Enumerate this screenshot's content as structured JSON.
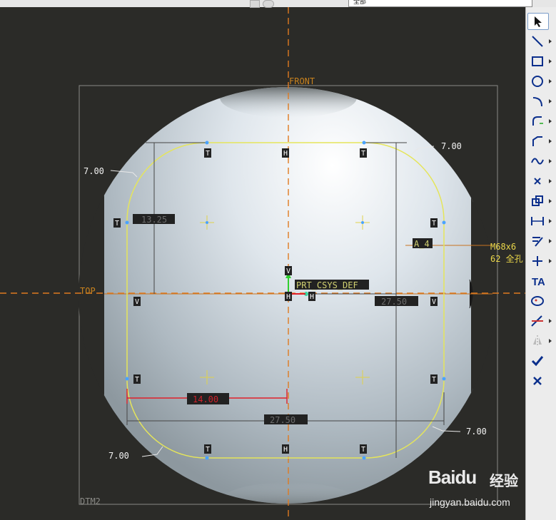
{
  "toolbar_top": {
    "combo_value": "全部"
  },
  "labels": {
    "front": "FRONT",
    "top": "TOP",
    "dtm2": "DTM2",
    "csys": "PRT_CSYS_DEF",
    "axis_a4": "A_4",
    "thread_1": "M68x6",
    "thread_2": "62 全孔"
  },
  "dimensions": {
    "r_top_left": "7.00",
    "r_top_right": "7.00",
    "r_bottom_left": "7.00",
    "r_bottom_right": "7.00",
    "height_half": "13.25",
    "width_half": "27.50",
    "width_full": "27.50",
    "offset": "14.00"
  },
  "constraints": {
    "tangent": "T",
    "horizontal": "H",
    "vertical": "V"
  },
  "watermark": {
    "logo": "Baidu",
    "cn": "经验",
    "url": "jingyan.baidu.com"
  },
  "sketch_tools": [
    "select-icon",
    "line-icon",
    "rectangle-icon",
    "circle-icon",
    "arc-icon",
    "fillet-icon",
    "chamfer-icon",
    "spline-icon",
    "point-icon",
    "offset-icon",
    "dimension-icon",
    "modify-icon",
    "constraint-icon",
    "text-icon",
    "palette-icon",
    "trim-icon",
    "mirror-icon",
    "accept-icon",
    "cancel-icon"
  ]
}
